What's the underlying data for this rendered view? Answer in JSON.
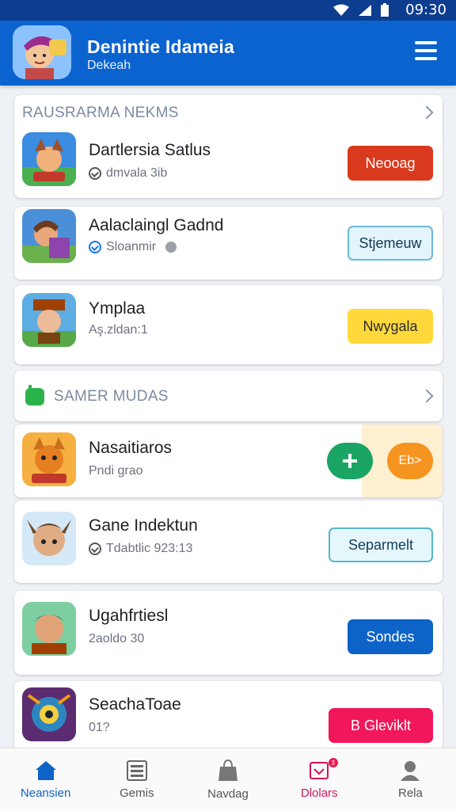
{
  "status_bar": {
    "time": "09:30"
  },
  "header": {
    "title": "Denintie Idameia",
    "subtitle": "Dekeah"
  },
  "sections": [
    {
      "title": "RAUSRARMA NEKMS"
    },
    {
      "title": "SAMER MUDAS"
    }
  ],
  "items": [
    {
      "title": "Dartlersia Satlus",
      "subtitle": "dmvala 3ib",
      "button": "Neooag"
    },
    {
      "title": "Aalaclaingl Gadnd",
      "subtitle": "Sloanmir",
      "button": "Stjemeuw"
    },
    {
      "title": "Ymplaa",
      "subtitle": "Aş.zldan:1",
      "button": "Nwygala"
    },
    {
      "title": "Nasaitiaros",
      "subtitle": "Pndi grao",
      "button": "Eb>"
    },
    {
      "title": "Gane Indektun",
      "subtitle": "Tdabtlic 923:13",
      "button": "Separmelt"
    },
    {
      "title": "Ugahfrtiesl",
      "subtitle": "2aoldo 30",
      "button": "Sondes"
    },
    {
      "title": "SeachaToae",
      "subtitle": "01?",
      "button": "B Gleviklt"
    }
  ],
  "nav": [
    {
      "label": "Neansien",
      "icon": "home-icon"
    },
    {
      "label": "Gemis",
      "icon": "list-icon"
    },
    {
      "label": "Navdag",
      "icon": "bag-icon"
    },
    {
      "label": "Dlolars",
      "icon": "notification-icon",
      "badge": "3"
    },
    {
      "label": "Rela",
      "icon": "profile-icon"
    }
  ],
  "colors": {
    "primary": "#0b63cf",
    "red": "#d93a1d",
    "yellow": "#ffd93b",
    "pink": "#f0185a",
    "green": "#1aa564",
    "orange": "#f69420"
  }
}
